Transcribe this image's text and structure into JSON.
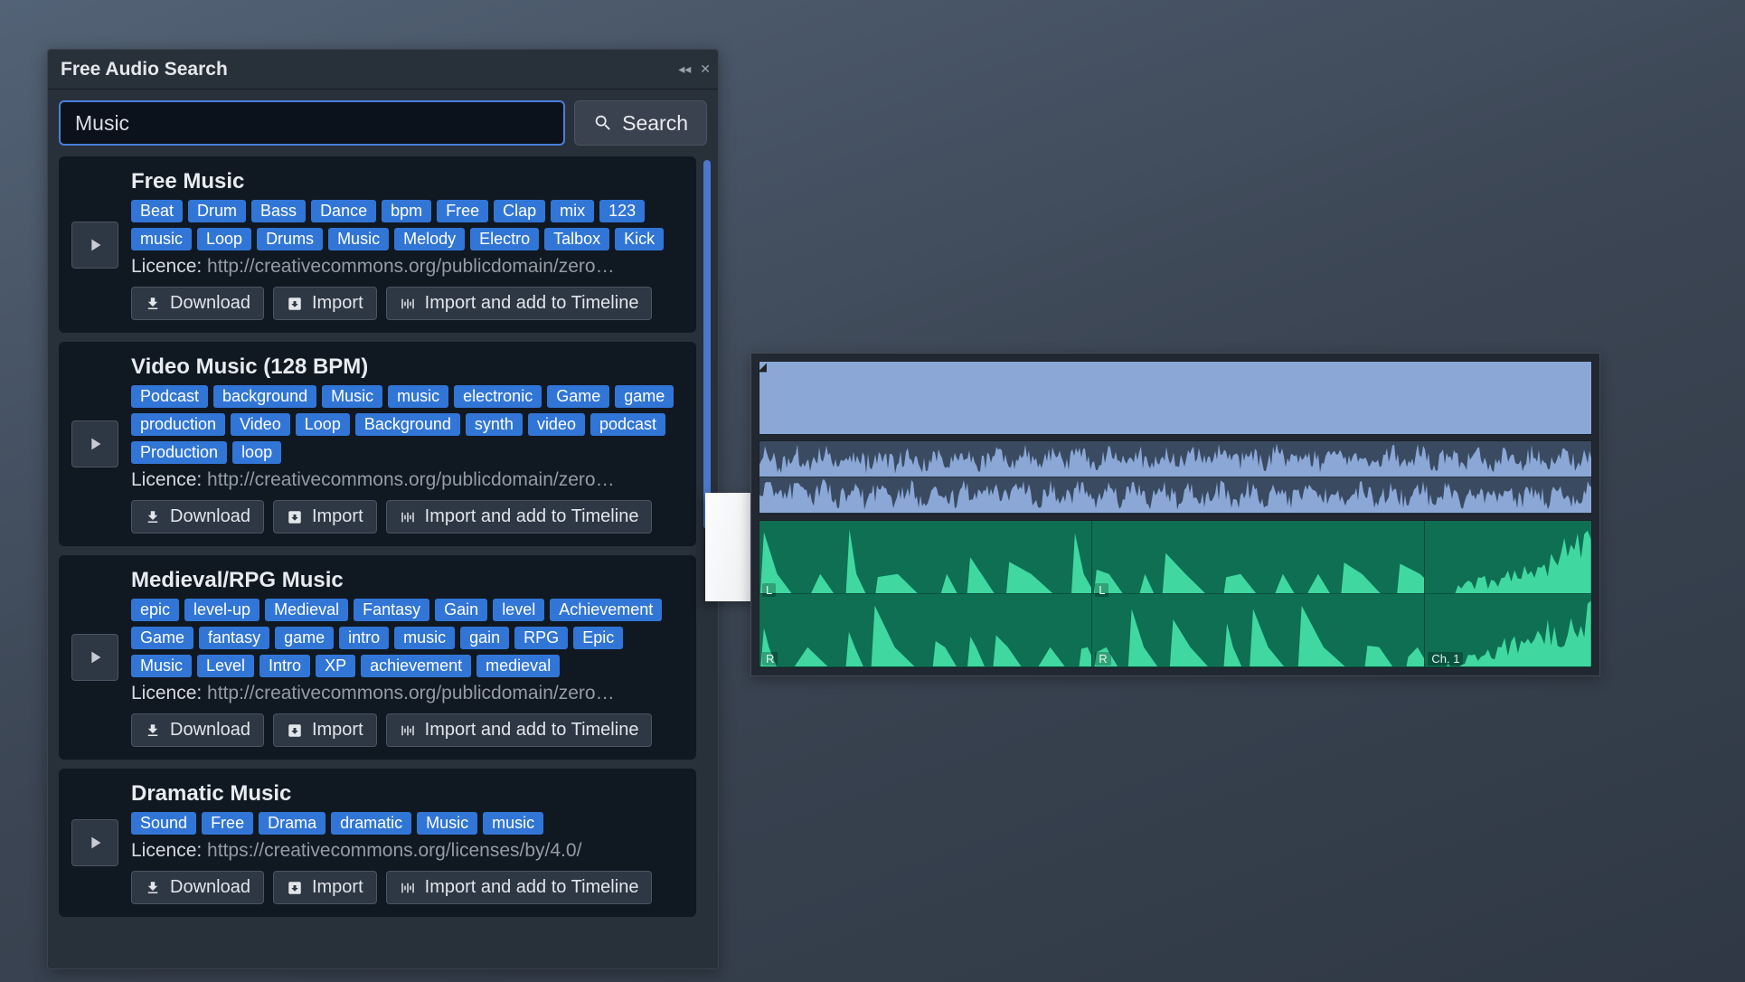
{
  "panel": {
    "title": "Free Audio Search",
    "search_value": "Music",
    "search_button": "Search"
  },
  "labels": {
    "download": "Download",
    "import": "Import",
    "import_timeline": "Import and add to Timeline",
    "licence_label": "Licence:"
  },
  "timeline": {
    "lane_L": "L",
    "lane_R": "R",
    "channel_label": "Ch. 1"
  },
  "results": [
    {
      "title": "Free Music",
      "tags": [
        "Beat",
        "Drum",
        "Bass",
        "Dance",
        "bpm",
        "Free",
        "Clap",
        "mix",
        "123",
        "music",
        "Loop",
        "Drums",
        "Music",
        "Melody",
        "Electro",
        "Talbox",
        "Kick"
      ],
      "licence": "http://creativecommons.org/publicdomain/zero…"
    },
    {
      "title": "Video Music (128 BPM)",
      "tags": [
        "Podcast",
        "background",
        "Music",
        "music",
        "electronic",
        "Game",
        "game",
        "production",
        "Video",
        "Loop",
        "Background",
        "synth",
        "video",
        "podcast",
        "Production",
        "loop"
      ],
      "licence": "http://creativecommons.org/publicdomain/zero…"
    },
    {
      "title": "Medieval/RPG Music",
      "tags": [
        "epic",
        "level-up",
        "Medieval",
        "Fantasy",
        "Gain",
        "level",
        "Achievement",
        "Game",
        "fantasy",
        "game",
        "intro",
        "music",
        "gain",
        "RPG",
        "Epic",
        "Music",
        "Level",
        "Intro",
        "XP",
        "achievement",
        "medieval"
      ],
      "licence": "http://creativecommons.org/publicdomain/zero…"
    },
    {
      "title": "Dramatic Music",
      "tags": [
        "Sound",
        "Free",
        "Drama",
        "dramatic",
        "Music",
        "music"
      ],
      "licence": "https://creativecommons.org/licenses/by/4.0/"
    }
  ]
}
